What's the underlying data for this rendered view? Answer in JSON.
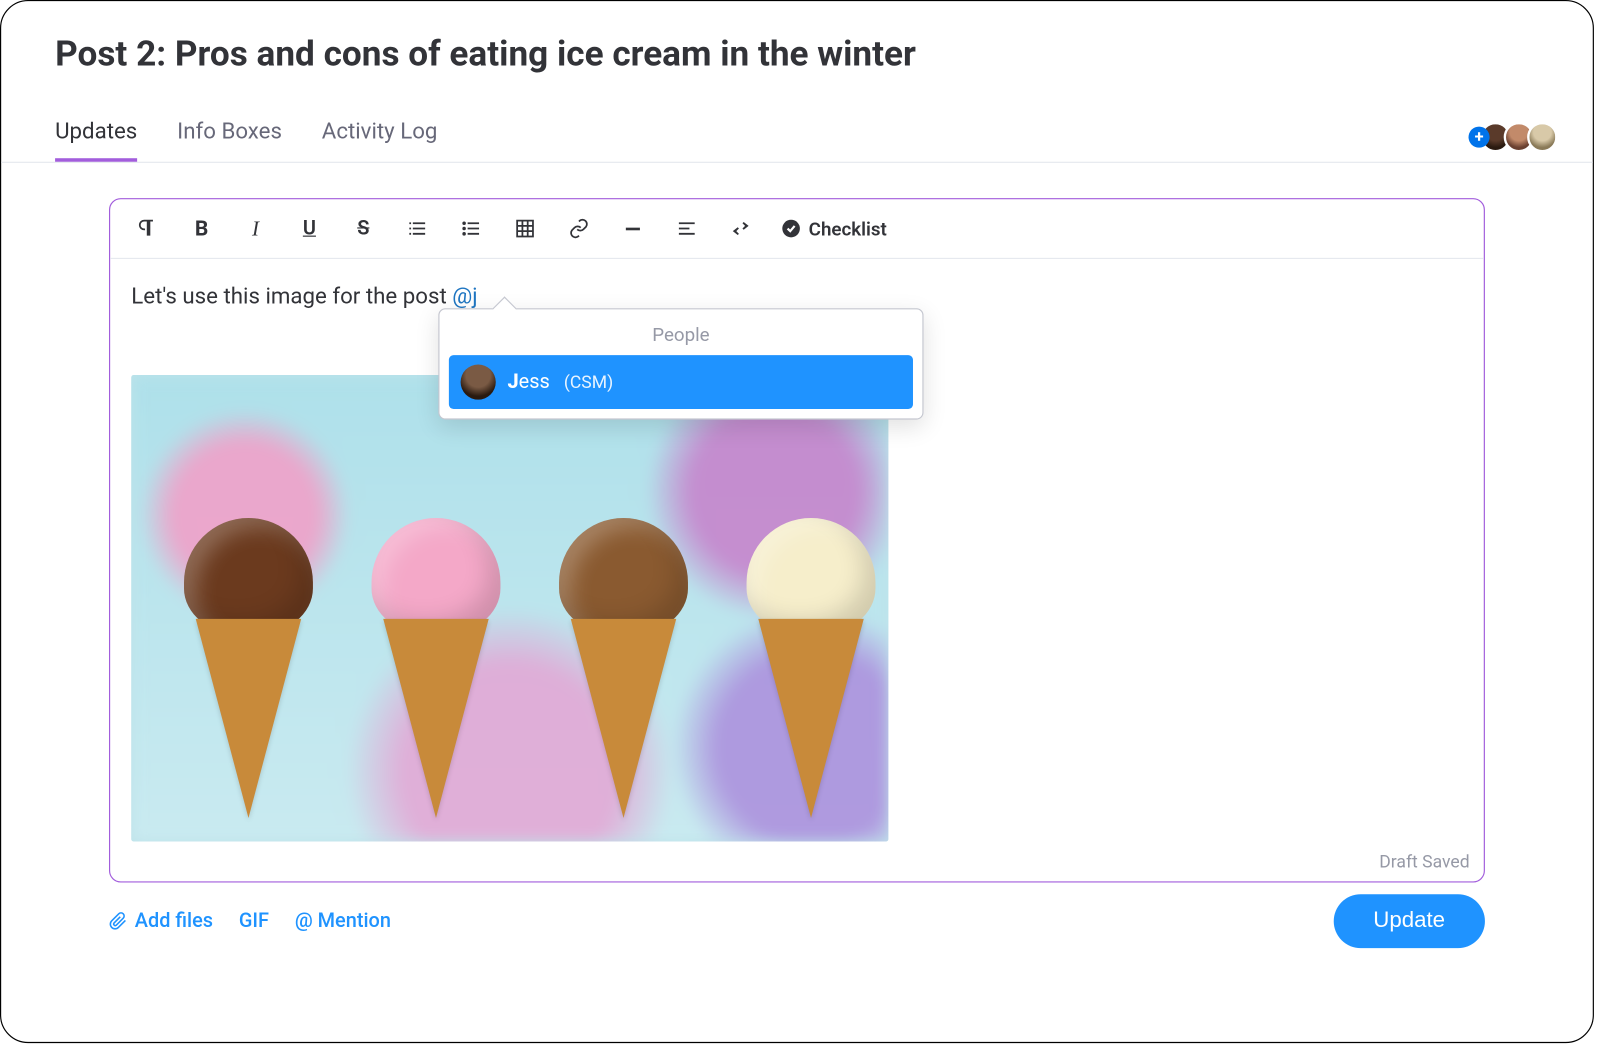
{
  "title": "Post 2: Pros and cons of eating ice cream in the winter",
  "tabs": [
    {
      "label": "Updates",
      "active": true
    },
    {
      "label": "Info Boxes",
      "active": false
    },
    {
      "label": "Activity Log",
      "active": false
    }
  ],
  "toolbar": {
    "checklist_label": "Checklist",
    "buttons": [
      "paragraph",
      "bold",
      "italic",
      "underline",
      "strikethrough",
      "ordered-list",
      "unordered-list",
      "table",
      "link",
      "hr",
      "align",
      "swap",
      "checklist"
    ]
  },
  "editor": {
    "text_prefix": "Let's use this image for the post ",
    "mention_query": "@j",
    "draft_status": "Draft Saved"
  },
  "mention_popover": {
    "section_title": "People",
    "results": [
      {
        "match_prefix": "J",
        "rest": "ess",
        "role": "(CSM)"
      }
    ]
  },
  "footer": {
    "add_files": "Add files",
    "gif": "GIF",
    "mention": "@ Mention",
    "submit": "Update"
  },
  "collaborators": {
    "add_icon": "plus",
    "count": 3
  }
}
